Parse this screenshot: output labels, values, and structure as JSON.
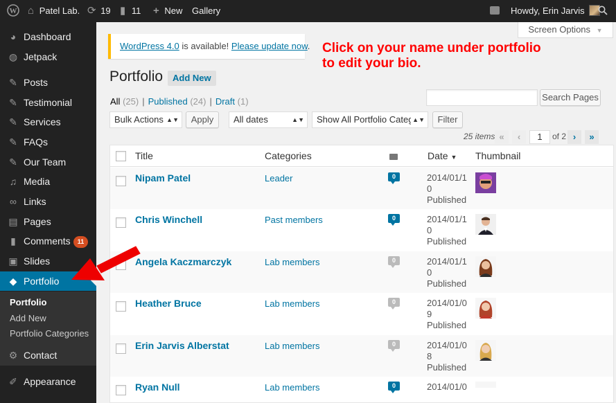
{
  "adminbar": {
    "site_name": "Patel Lab.",
    "updates_count": "19",
    "comments_count": "11",
    "new_label": "New",
    "gallery_label": "Gallery",
    "howdy": "Howdy, Erin Jarvis"
  },
  "sidebar": {
    "items": [
      {
        "label": "Dashboard",
        "icon": "dashboard-icon"
      },
      {
        "label": "Jetpack",
        "icon": "jetpack-icon"
      },
      {
        "label": "Posts",
        "icon": "pin-icon"
      },
      {
        "label": "Testimonial",
        "icon": "pin-icon"
      },
      {
        "label": "Services",
        "icon": "pin-icon"
      },
      {
        "label": "FAQs",
        "icon": "pin-icon"
      },
      {
        "label": "Our Team",
        "icon": "pin-icon"
      },
      {
        "label": "Media",
        "icon": "media-icon"
      },
      {
        "label": "Links",
        "icon": "links-icon"
      },
      {
        "label": "Pages",
        "icon": "pages-icon"
      },
      {
        "label": "Comments",
        "icon": "comments-icon",
        "badge": "11"
      },
      {
        "label": "Slides",
        "icon": "slides-icon"
      },
      {
        "label": "Portfolio",
        "icon": "portfolio-icon"
      },
      {
        "label": "Contact",
        "icon": "contact-icon"
      },
      {
        "label": "Appearance",
        "icon": "appearance-icon"
      }
    ],
    "submenu": [
      "Portfolio",
      "Add New",
      "Portfolio Categories"
    ]
  },
  "screen_options": "Screen Options",
  "notice": {
    "link1": "WordPress 4.0",
    "text": " is available! ",
    "link2": "Please update now",
    "end": "."
  },
  "annotation": {
    "line1": "Click on your name under portfolio",
    "line2": "to edit your bio."
  },
  "page_title": "Portfolio",
  "add_new": "Add New",
  "views": {
    "all": "All",
    "all_count": "(25)",
    "published": "Published",
    "published_count": "(24)",
    "draft": "Draft",
    "draft_count": "(1)"
  },
  "search_button": "Search Pages",
  "bulk_actions": "Bulk Actions",
  "apply": "Apply",
  "all_dates": "All dates",
  "category_filter": "Show All Portfolio Categor",
  "filter": "Filter",
  "pagination": {
    "items": "25 items",
    "first": "«",
    "prev": "‹",
    "current_page": "1",
    "of_pages": "of 2",
    "next": "›",
    "last": "»"
  },
  "table": {
    "headers": {
      "title": "Title",
      "categories": "Categories",
      "date": "Date",
      "thumbnail": "Thumbnail"
    },
    "rows": [
      {
        "title": "Nipam Patel",
        "category": "Leader",
        "comments": "0",
        "comment_color": "blue",
        "date1": "2014/01/1",
        "date2": "0",
        "status": "Published",
        "thumb": "purple"
      },
      {
        "title": "Chris Winchell",
        "category": "Past members",
        "comments": "0",
        "comment_color": "blue",
        "date1": "2014/01/1",
        "date2": "0",
        "status": "Published",
        "thumb": "suit"
      },
      {
        "title": "Angela Kaczmarczyk",
        "category": "Lab members",
        "comments": "0",
        "comment_color": "grey",
        "date1": "2014/01/1",
        "date2": "0",
        "status": "Published",
        "thumb": "brown"
      },
      {
        "title": "Heather Bruce",
        "category": "Lab members",
        "comments": "0",
        "comment_color": "grey",
        "date1": "2014/01/0",
        "date2": "9",
        "status": "Published",
        "thumb": "red"
      },
      {
        "title": "Erin Jarvis Alberstat",
        "category": "Lab members",
        "comments": "0",
        "comment_color": "grey",
        "date1": "2014/01/0",
        "date2": "8",
        "status": "Published",
        "thumb": "blonde"
      },
      {
        "title": "Ryan Null",
        "category": "Lab members",
        "comments": "0",
        "comment_color": "blue",
        "date1": "2014/01/0",
        "date2": "",
        "status": "",
        "thumb": "ryan"
      }
    ]
  },
  "colors": {
    "accent": "#0074a2",
    "adminbar": "#222222",
    "annotation": "#ff0000",
    "badge": "#d54e21"
  }
}
